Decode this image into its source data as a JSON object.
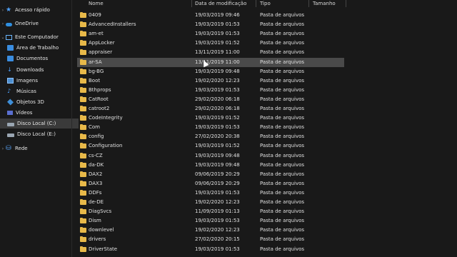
{
  "sidebar": {
    "items": [
      {
        "label": "Acesso rápido",
        "icon": "star-icon"
      },
      {
        "label": "OneDrive",
        "icon": "cloud-icon"
      },
      {
        "label": "Este Computador",
        "icon": "computer-icon"
      },
      {
        "label": "Área de Trabalho",
        "icon": "desktop-folder-icon"
      },
      {
        "label": "Documentos",
        "icon": "documents-icon"
      },
      {
        "label": "Downloads",
        "icon": "download-icon"
      },
      {
        "label": "Imagens",
        "icon": "pictures-icon"
      },
      {
        "label": "Músicas",
        "icon": "music-icon"
      },
      {
        "label": "Objetos 3D",
        "icon": "3d-objects-icon"
      },
      {
        "label": "Vídeos",
        "icon": "videos-icon"
      },
      {
        "label": "Disco Local (C:)",
        "icon": "drive-icon"
      },
      {
        "label": "Disco Local (E:)",
        "icon": "drive-icon"
      },
      {
        "label": "Rede",
        "icon": "network-icon"
      }
    ]
  },
  "columns": {
    "name": "Nome",
    "date": "Data de modificação",
    "type": "Tipo",
    "size": "Tamanho"
  },
  "rows": [
    {
      "name": "0409",
      "date": "19/03/2019 09:46",
      "type": "Pasta de arquivos"
    },
    {
      "name": "AdvancedInstallers",
      "date": "19/03/2019 01:53",
      "type": "Pasta de arquivos"
    },
    {
      "name": "am-et",
      "date": "19/03/2019 01:53",
      "type": "Pasta de arquivos"
    },
    {
      "name": "AppLocker",
      "date": "19/03/2019 01:52",
      "type": "Pasta de arquivos"
    },
    {
      "name": "appraiser",
      "date": "13/11/2019 11:00",
      "type": "Pasta de arquivos"
    },
    {
      "name": "ar-SA",
      "date": "13/11/2019 11:00",
      "type": "Pasta de arquivos"
    },
    {
      "name": "bg-BG",
      "date": "19/03/2019 09:48",
      "type": "Pasta de arquivos"
    },
    {
      "name": "Boot",
      "date": "19/02/2020 12:23",
      "type": "Pasta de arquivos"
    },
    {
      "name": "Bthprops",
      "date": "19/03/2019 01:53",
      "type": "Pasta de arquivos"
    },
    {
      "name": "CatRoot",
      "date": "29/02/2020 06:18",
      "type": "Pasta de arquivos"
    },
    {
      "name": "catroot2",
      "date": "29/02/2020 06:18",
      "type": "Pasta de arquivos"
    },
    {
      "name": "CodeIntegrity",
      "date": "19/03/2019 01:52",
      "type": "Pasta de arquivos"
    },
    {
      "name": "Com",
      "date": "19/03/2019 01:53",
      "type": "Pasta de arquivos"
    },
    {
      "name": "config",
      "date": "27/02/2020 20:38",
      "type": "Pasta de arquivos"
    },
    {
      "name": "Configuration",
      "date": "19/03/2019 01:52",
      "type": "Pasta de arquivos"
    },
    {
      "name": "cs-CZ",
      "date": "19/03/2019 09:48",
      "type": "Pasta de arquivos"
    },
    {
      "name": "da-DK",
      "date": "19/03/2019 09:48",
      "type": "Pasta de arquivos"
    },
    {
      "name": "DAX2",
      "date": "09/06/2019 20:29",
      "type": "Pasta de arquivos"
    },
    {
      "name": "DAX3",
      "date": "09/06/2019 20:29",
      "type": "Pasta de arquivos"
    },
    {
      "name": "DDFs",
      "date": "19/03/2019 01:53",
      "type": "Pasta de arquivos"
    },
    {
      "name": "de-DE",
      "date": "19/02/2020 12:23",
      "type": "Pasta de arquivos"
    },
    {
      "name": "DiagSvcs",
      "date": "11/09/2019 01:13",
      "type": "Pasta de arquivos"
    },
    {
      "name": "Dism",
      "date": "19/03/2019 01:53",
      "type": "Pasta de arquivos"
    },
    {
      "name": "downlevel",
      "date": "19/02/2020 12:23",
      "type": "Pasta de arquivos"
    },
    {
      "name": "drivers",
      "date": "27/02/2020 20:15",
      "type": "Pasta de arquivos"
    },
    {
      "name": "DriverState",
      "date": "19/03/2019 01:53",
      "type": "Pasta de arquivos"
    }
  ],
  "selected_row": "ar-SA"
}
